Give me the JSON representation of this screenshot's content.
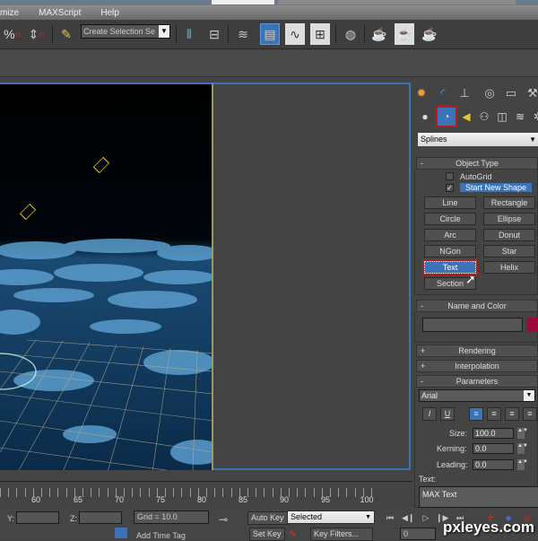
{
  "menubar": {
    "items": [
      "mize",
      "MAXScript",
      "Help"
    ]
  },
  "toolbar": {
    "selection_set_placeholder": "Create Selection Se",
    "icons": [
      "percent-snap-icon",
      "spinner-snap-icon",
      "edit-named-selection-icon",
      "mirror-icon",
      "align-icon",
      "layer-manager-icon",
      "scene-explorer-icon",
      "curve-editor-icon",
      "schematic-view-icon",
      "material-editor-icon",
      "render-setup-icon",
      "rendered-frame-window-icon",
      "render-production-icon"
    ]
  },
  "command_panel": {
    "tabs": [
      "create",
      "modify",
      "hierarchy",
      "motion",
      "display",
      "utilities"
    ],
    "subcategories": [
      "geometry",
      "shapes",
      "lights",
      "cameras",
      "helpers",
      "space-warps",
      "systems"
    ],
    "active_subcategory": "shapes",
    "category_dropdown": "Splines",
    "object_type": {
      "title": "Object Type",
      "autogrid_label": "AutoGrid",
      "autogrid_checked": false,
      "start_new_shape_label": "Start New Shape",
      "start_new_shape_checked": true,
      "buttons": [
        "Line",
        "Rectangle",
        "Circle",
        "Ellipse",
        "Arc",
        "Donut",
        "NGon",
        "Star",
        "Text",
        "Helix",
        "Section"
      ],
      "active_button": "Text"
    },
    "name_and_color": {
      "title": "Name and Color",
      "name_value": "",
      "color": "#9a0a3a"
    },
    "rendering": {
      "title": "Rendering"
    },
    "interpolation": {
      "title": "Interpolation"
    },
    "parameters": {
      "title": "Parameters",
      "font": "Arial",
      "format_buttons": [
        "I",
        "U",
        "align-left",
        "align-center",
        "align-right",
        "justify"
      ],
      "size_label": "Size:",
      "size_value": "100.0",
      "kerning_label": "Kerning:",
      "kerning_value": "0.0",
      "leading_label": "Leading:",
      "leading_value": "0.0",
      "text_label": "Text:",
      "text_value": "MAX Text"
    }
  },
  "timeline": {
    "ticks": [
      "60",
      "65",
      "70",
      "75",
      "80",
      "85",
      "90",
      "95",
      "100"
    ]
  },
  "statusbar": {
    "y_label": "Y:",
    "z_label": "Z:",
    "grid": "Grid = 10.0",
    "auto_key": "Auto Key",
    "set_key": "Set Key",
    "key_mode": "Selected",
    "key_filters": "Key Filters...",
    "add_time_tag": "Add Time Tag",
    "frame_value": "0"
  },
  "watermark": "pxleyes.com"
}
